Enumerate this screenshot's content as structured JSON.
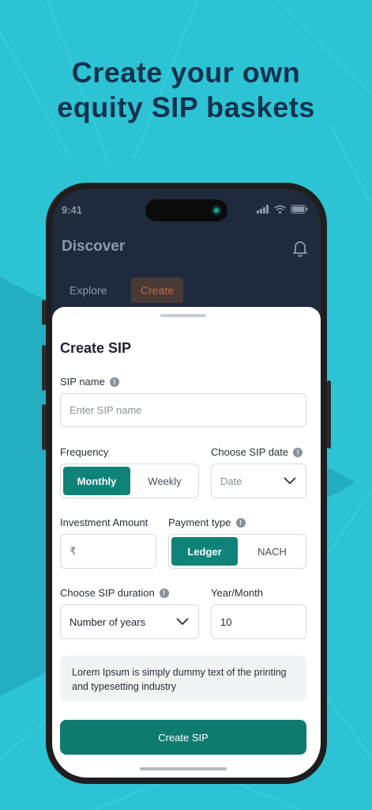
{
  "headline": {
    "line1": "Create your own",
    "line2": "equity SIP baskets"
  },
  "status_bar": {
    "time": "9:41"
  },
  "app": {
    "title": "Discover"
  },
  "tabs": [
    {
      "label": "Explore"
    },
    {
      "label": "Create"
    }
  ],
  "form": {
    "title": "Create SIP",
    "sip_name": {
      "label": "SIP name",
      "placeholder": "Enter SIP name"
    },
    "frequency": {
      "label": "Frequency",
      "options": [
        "Monthly",
        "Weekly"
      ],
      "selected": "Monthly"
    },
    "sip_date": {
      "label": "Choose SIP date",
      "placeholder": "Date"
    },
    "investment": {
      "label": "Investment Amount",
      "currency_symbol": "₹"
    },
    "payment_type": {
      "label": "Payment type",
      "options": [
        "Ledger",
        "NACH"
      ],
      "selected": "Ledger"
    },
    "duration": {
      "label": "Choose SIP duration",
      "value": "Number of years"
    },
    "year_month": {
      "label": "Year/Month",
      "value": "10"
    },
    "note": "Lorem Ipsum is simply dummy text of the printing and typesetting industry",
    "submit_label": "Create SIP"
  },
  "colors": {
    "background": "#2cc4d4",
    "accent": "#0f8377",
    "headline": "#12314d",
    "phone_screen": "#1f2b3c"
  }
}
